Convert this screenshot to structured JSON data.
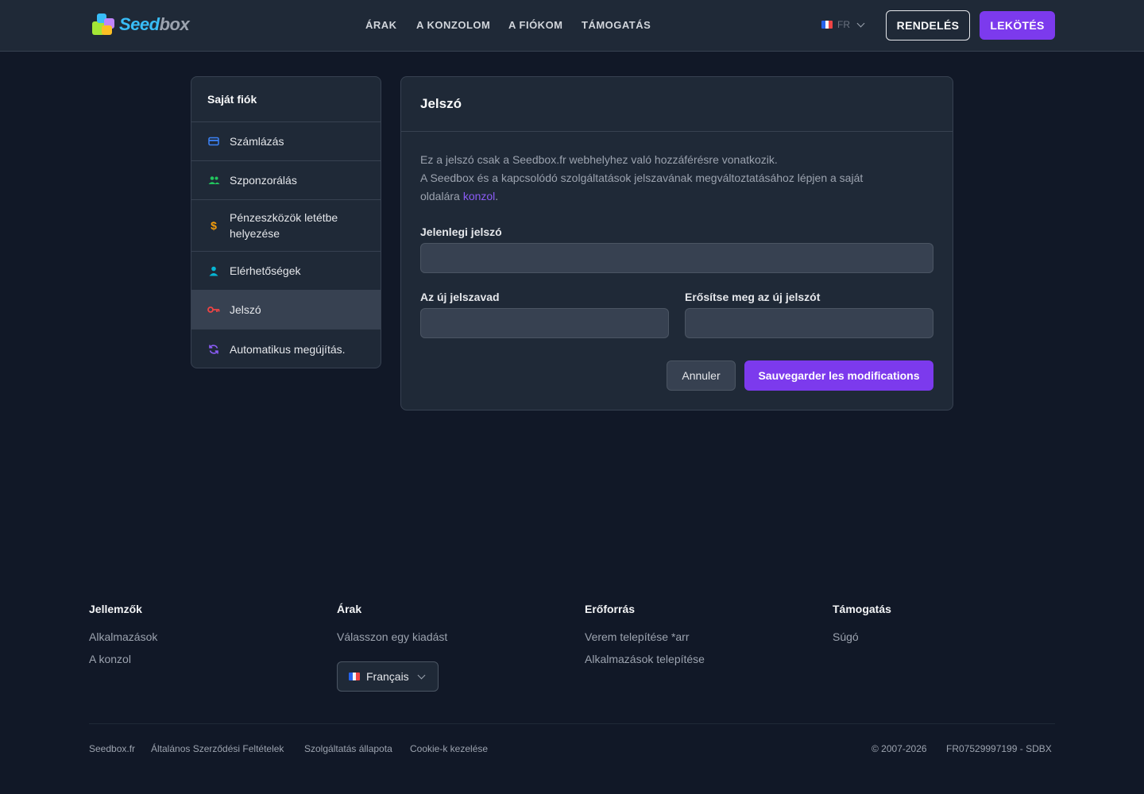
{
  "header": {
    "logo": {
      "part1": "Seed",
      "part2": "box"
    },
    "nav": [
      "ÁRAK",
      "A KONZOLOM",
      "A FIÓKOM",
      "TÁMOGATÁS"
    ],
    "lang": "FR",
    "order_label": "RENDELÉS",
    "login_label": "LEKÖTÉS"
  },
  "sidebar": {
    "title": "Saját fiók",
    "items": [
      {
        "label": "Számlázás",
        "icon": "credit-card-icon",
        "color": "#3b82f6"
      },
      {
        "label": "Szponzorálás",
        "icon": "users-icon",
        "color": "#22c55e"
      },
      {
        "label": "Pénzeszközök letétbe helyezése",
        "icon": "dollar-icon",
        "color": "#f59e0b"
      },
      {
        "label": "Elérhetőségek",
        "icon": "user-icon",
        "color": "#06b6d4"
      },
      {
        "label": "Jelszó",
        "icon": "key-icon",
        "color": "#ef4444",
        "active": true
      },
      {
        "label": "Automatikus megújítás.",
        "icon": "refresh-icon",
        "color": "#8b5cf6"
      }
    ]
  },
  "main": {
    "title": "Jelszó",
    "desc_line1": "Ez a jelszó csak a Seedbox.fr webhelyhez való hozzáférésre vonatkozik.",
    "desc_line2": "A Seedbox és a kapcsolódó szolgáltatások jelszavának megváltoztatásához lépjen a saját oldalára",
    "desc_link": "konzol",
    "current_label": "Jelenlegi jelszó",
    "new_label": "Az új jelszavad",
    "confirm_label": "Erősítse meg az új jelszót",
    "cancel_label": "Annuler",
    "save_label": "Sauvegarder les modifications"
  },
  "footer": {
    "col1": {
      "title": "Jellemzők",
      "links": [
        "Alkalmazások",
        "A konzol"
      ]
    },
    "col2": {
      "title": "Árak",
      "links": [
        "Válasszon egy kiadást"
      ]
    },
    "col3": {
      "title": "Erőforrás",
      "links": [
        "Verem telepítése *arr",
        "Alkalmazások telepítése"
      ]
    },
    "col4": {
      "title": "Támogatás",
      "links": [
        "Súgó"
      ]
    },
    "lang_select": "Français",
    "legal_links": [
      "Seedbox.fr",
      "Általános Szerződési Feltételek",
      "Szolgáltatás állapota",
      "Cookie-k kezelése"
    ],
    "copyright": "© 2007-2026",
    "company_id": "FR07529997199 - SDBX"
  },
  "colors": {
    "accent": "#7c3aed",
    "background": "#111827",
    "panel": "#1f2937"
  }
}
